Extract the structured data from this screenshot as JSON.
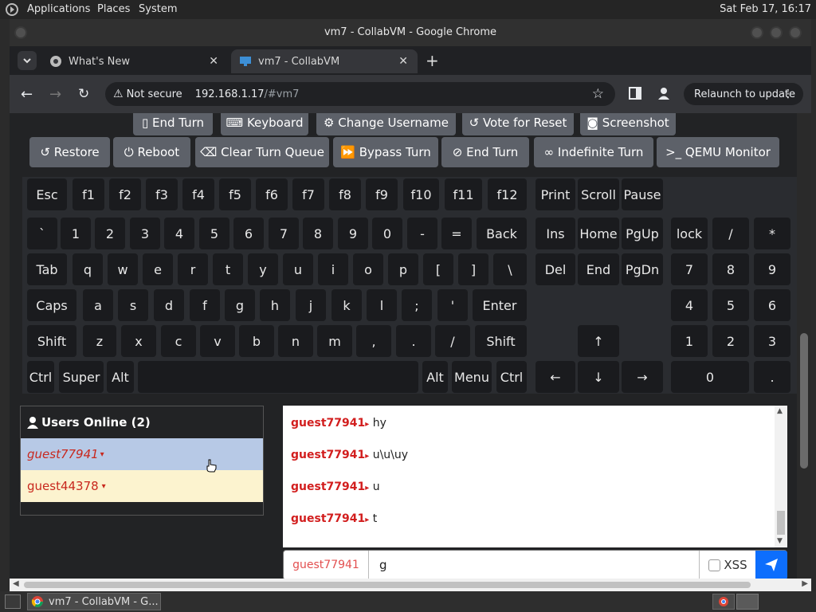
{
  "top_panel": {
    "menus": [
      "Applications",
      "Places",
      "System"
    ],
    "clock": "Sat Feb 17, 16:17"
  },
  "window": {
    "title": "vm7 - CollabVM - Google Chrome"
  },
  "tabs": [
    {
      "label": "What's New"
    },
    {
      "label": "vm7 - CollabVM"
    }
  ],
  "toolbar": {
    "security": "Not secure",
    "url_host": "192.168.1.17",
    "url_path": "/#vm7",
    "relaunch_label": "Relaunch to update"
  },
  "vm_controls": {
    "row1": [
      "End Turn",
      "Keyboard",
      "Change Username",
      "Vote for Reset",
      "Screenshot"
    ],
    "row2": [
      "Restore",
      "Reboot",
      "Clear Turn Queue",
      "Bypass Turn",
      "End Turn",
      "Indefinite Turn",
      "QEMU Monitor"
    ]
  },
  "keyboard": {
    "fn_row": [
      "Esc",
      "f1",
      "f2",
      "f3",
      "f4",
      "f5",
      "f6",
      "f7",
      "f8",
      "f9",
      "f10",
      "f11",
      "f12"
    ],
    "sys_keys": [
      "Print",
      "Scroll",
      "Pause"
    ],
    "num_row": [
      "`",
      "1",
      "2",
      "3",
      "4",
      "5",
      "6",
      "7",
      "8",
      "9",
      "0",
      "-",
      "=",
      "Back"
    ],
    "q_row": [
      "Tab",
      "q",
      "w",
      "e",
      "r",
      "t",
      "y",
      "u",
      "i",
      "o",
      "p",
      "[",
      "]",
      "\\"
    ],
    "a_row": [
      "Caps",
      "a",
      "s",
      "d",
      "f",
      "g",
      "h",
      "j",
      "k",
      "l",
      ";",
      "'",
      "Enter"
    ],
    "z_row": [
      "Shift",
      "z",
      "x",
      "c",
      "v",
      "b",
      "n",
      "m",
      ",",
      ".",
      "/",
      "Shift"
    ],
    "bottom_row": [
      "Ctrl",
      "Super",
      "Alt",
      "",
      "Alt",
      "Menu",
      "Ctrl"
    ],
    "nav_top": [
      "Ins",
      "Home",
      "PgUp"
    ],
    "nav_bottom": [
      "Del",
      "End",
      "PgDn"
    ],
    "arrows": [
      "↑",
      "←",
      "↓",
      "→"
    ],
    "numpad": [
      "lock",
      "/",
      "*",
      "7",
      "8",
      "9",
      "4",
      "5",
      "6",
      "1",
      "2",
      "3",
      "0",
      "."
    ]
  },
  "users": {
    "title": "Users Online (2)",
    "list": [
      "guest77941",
      "guest44378"
    ]
  },
  "chat": {
    "messages": [
      {
        "user": "guest77941",
        "text": "hy"
      },
      {
        "user": "guest77941",
        "text": "u\\u\\uy"
      },
      {
        "user": "guest77941",
        "text": "u"
      },
      {
        "user": "guest77941",
        "text": "t"
      }
    ],
    "input_user": "guest77941",
    "input_value": "g",
    "xss_label": "XSS"
  },
  "taskbar": {
    "item": "vm7 - CollabVM - G..."
  }
}
